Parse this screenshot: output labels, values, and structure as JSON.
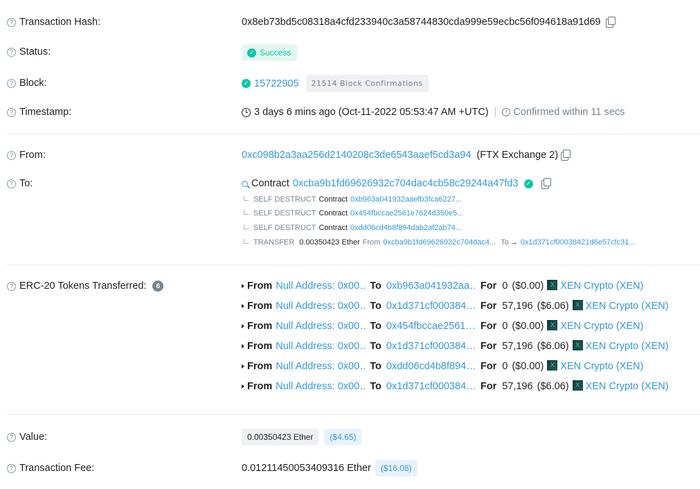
{
  "labels": {
    "tx_hash": "Transaction Hash:",
    "status": "Status:",
    "block": "Block:",
    "timestamp": "Timestamp:",
    "from": "From:",
    "to": "To:",
    "erc20": "ERC-20 Tokens Transferred:",
    "value": "Value:",
    "fee": "Transaction Fee:"
  },
  "help_glyph": "?",
  "tx_hash": "0x8eb73bd5c08318a4cfd233940c3a58744830cda999e59ecbc56f094618a91d69",
  "status": "Success",
  "block": {
    "number": "15722905",
    "confirmations": "21514 Block Confirmations"
  },
  "timestamp": {
    "text": "3 days 6 mins ago (Oct-11-2022 05:53:47 AM +UTC)",
    "separator": "|",
    "confirmed": "Confirmed within 11 secs"
  },
  "from": {
    "address": "0xc098b2a3aa256d2140208c3de6543aaef5cd3a94",
    "name": "(FTX Exchange 2)"
  },
  "to": {
    "prefix": "Contract",
    "address": "0xcba9b1fd69626932c704dac4cb58c29244a47fd3",
    "traces": [
      {
        "type": "SELF DESTRUCT",
        "kind": "Contract",
        "address": "0xb963a041932aaefb3fca6227..."
      },
      {
        "type": "SELF DESTRUCT",
        "kind": "Contract",
        "address": "0x454fbccae2561e7624d350e5..."
      },
      {
        "type": "SELF DESTRUCT",
        "kind": "Contract",
        "address": "0xdd06cd4b8f894dab2af2ab74..."
      }
    ],
    "transfer": {
      "type": "TRANSFER",
      "amount": "0.00350423 Ether",
      "from_label": "From",
      "from_addr": "0xcba9b1fd69626932c704dac4...",
      "to_label": "To",
      "arrow": "→",
      "to_addr": "0x1d371cf00038421d6e57cfc31..."
    }
  },
  "erc20": {
    "count": "6",
    "from_label": "From",
    "to_label": "To",
    "for_label": "For",
    "rows": [
      {
        "from": "Null Address: 0x00…",
        "to": "0xb963a041932aa…",
        "amount": "0",
        "usd": "($0.00)",
        "token": "XEN Crypto (XEN)"
      },
      {
        "from": "Null Address: 0x00…",
        "to": "0x1d371cf000384…",
        "amount": "57,196",
        "usd": "($6.06)",
        "token": "XEN Crypto (XEN)"
      },
      {
        "from": "Null Address: 0x00…",
        "to": "0x454fbccae2561…",
        "amount": "0",
        "usd": "($0.00)",
        "token": "XEN Crypto (XEN)"
      },
      {
        "from": "Null Address: 0x00…",
        "to": "0x1d371cf000384…",
        "amount": "57,196",
        "usd": "($6.06)",
        "token": "XEN Crypto (XEN)"
      },
      {
        "from": "Null Address: 0x00…",
        "to": "0xdd06cd4b8f894…",
        "amount": "0",
        "usd": "($0.00)",
        "token": "XEN Crypto (XEN)"
      },
      {
        "from": "Null Address: 0x00…",
        "to": "0x1d371cf000384…",
        "amount": "57,196",
        "usd": "($6.06)",
        "token": "XEN Crypto (XEN)"
      }
    ],
    "token_icon_glyph": "X"
  },
  "value": {
    "ether": "0.00350423 Ether",
    "usd": "($4.65)"
  },
  "fee": {
    "ether": "0.01211450053409316 Ether",
    "usd": "($16.08)"
  },
  "colors": {
    "link": "#3498db",
    "success": "#00c9a7",
    "muted": "#77838f"
  }
}
